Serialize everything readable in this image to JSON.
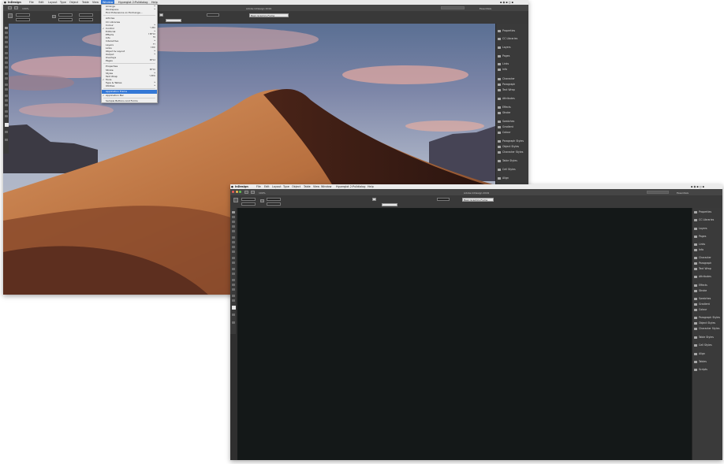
{
  "window1": {
    "app_menu": [
      "InDesign",
      "File",
      "Edit",
      "Layout",
      "Type",
      "Object",
      "Table",
      "View",
      "Window",
      "Hyperglot 2:Pulldialog",
      "Help"
    ],
    "active_menu": "Window",
    "doc_title": "Adobe InDesign 2019",
    "zoom": "100%",
    "workspace": "Essentials",
    "field_value": "Basic Graphics Frame",
    "window_menu": {
      "items": [
        {
          "label": "Arrange",
          "shortcut": "▸",
          "checked": false
        },
        {
          "label": "Workspace",
          "shortcut": "▸",
          "checked": false
        },
        {
          "label": "Find Extensions on Exchange...",
          "shortcut": "",
          "checked": false
        },
        {
          "sep": true
        },
        {
          "label": "Articles",
          "shortcut": "",
          "checked": false
        },
        {
          "label": "CC Libraries",
          "shortcut": "",
          "checked": false
        },
        {
          "label": "Colour",
          "shortcut": "▸",
          "checked": false
        },
        {
          "label": "Control",
          "shortcut": "⌥⌘6",
          "checked": true
        },
        {
          "label": "Editorial",
          "shortcut": "▸",
          "checked": false
        },
        {
          "label": "Effects",
          "shortcut": "⇧⌘F10",
          "checked": false
        },
        {
          "label": "Info",
          "shortcut": "F8",
          "checked": false
        },
        {
          "label": "Interactive",
          "shortcut": "▸",
          "checked": false
        },
        {
          "label": "Layers",
          "shortcut": "F7",
          "checked": false
        },
        {
          "label": "Links",
          "shortcut": "⇧⌘D",
          "checked": false
        },
        {
          "label": "Object & Layout",
          "shortcut": "▸",
          "checked": false
        },
        {
          "label": "Output",
          "shortcut": "▸",
          "checked": false
        },
        {
          "label": "Overlays",
          "shortcut": "",
          "checked": false
        },
        {
          "label": "Pages",
          "shortcut": "⌘F12",
          "checked": false
        },
        {
          "sep": true
        },
        {
          "label": "Properties",
          "shortcut": "",
          "checked": false
        },
        {
          "label": "Stroke",
          "shortcut": "⌘F10",
          "checked": false
        },
        {
          "label": "Styles",
          "shortcut": "▸",
          "checked": false
        },
        {
          "label": "Text Wrap",
          "shortcut": "⌥⌘W",
          "checked": false
        },
        {
          "label": "Tools",
          "shortcut": "",
          "checked": true
        },
        {
          "label": "Type & Tables",
          "shortcut": "▸",
          "checked": false
        },
        {
          "label": "Utilities",
          "shortcut": "▸",
          "checked": false
        },
        {
          "sep": true
        },
        {
          "label": "Application Frame",
          "shortcut": "",
          "checked": false,
          "selected": true
        },
        {
          "label": "Application Bar",
          "shortcut": "",
          "checked": true
        },
        {
          "sep": true
        },
        {
          "label": "Sample Buttons And Forms",
          "shortcut": "",
          "checked": false
        }
      ]
    },
    "panels": [
      "Properties",
      "CC Libraries",
      "Layers",
      "Pages",
      "Links",
      "Info",
      "Character",
      "Paragraph",
      "Text Wrap",
      "Attributes",
      "Effects",
      "Stroke",
      "Swatches",
      "Gradient",
      "Colour",
      "Paragraph Styles",
      "Object Styles",
      "Character Styles",
      "Table Styles",
      "Cell Styles",
      "Align"
    ]
  },
  "window2": {
    "app_menu": [
      "InDesign",
      "File",
      "Edit",
      "Layout",
      "Type",
      "Object",
      "Table",
      "View",
      "Window",
      "Hyperglot 2:Pulldialog",
      "Help"
    ],
    "doc_title": "Adobe InDesign 2019",
    "zoom": "100%",
    "workspace": "Essentials",
    "field_value": "Basic Graphics Frame",
    "panels": [
      "Properties",
      "CC Libraries",
      "Layers",
      "Pages",
      "Links",
      "Info",
      "Character",
      "Paragraph",
      "Text Wrap",
      "Attributes",
      "Effects",
      "Stroke",
      "Swatches",
      "Gradient",
      "Colour",
      "Paragraph Styles",
      "Object Styles",
      "Character Styles",
      "Table Styles",
      "Cell Styles",
      "Align",
      "Tables",
      "Scripts"
    ]
  },
  "colors": {
    "menubar": "#e9e9e9",
    "chrome": "#393939",
    "panel": "#3a3a3a",
    "highlight": "#3478d6",
    "dark_canvas": "#141818",
    "sky_top": "#2f4a73",
    "dune": "#c07a45"
  }
}
